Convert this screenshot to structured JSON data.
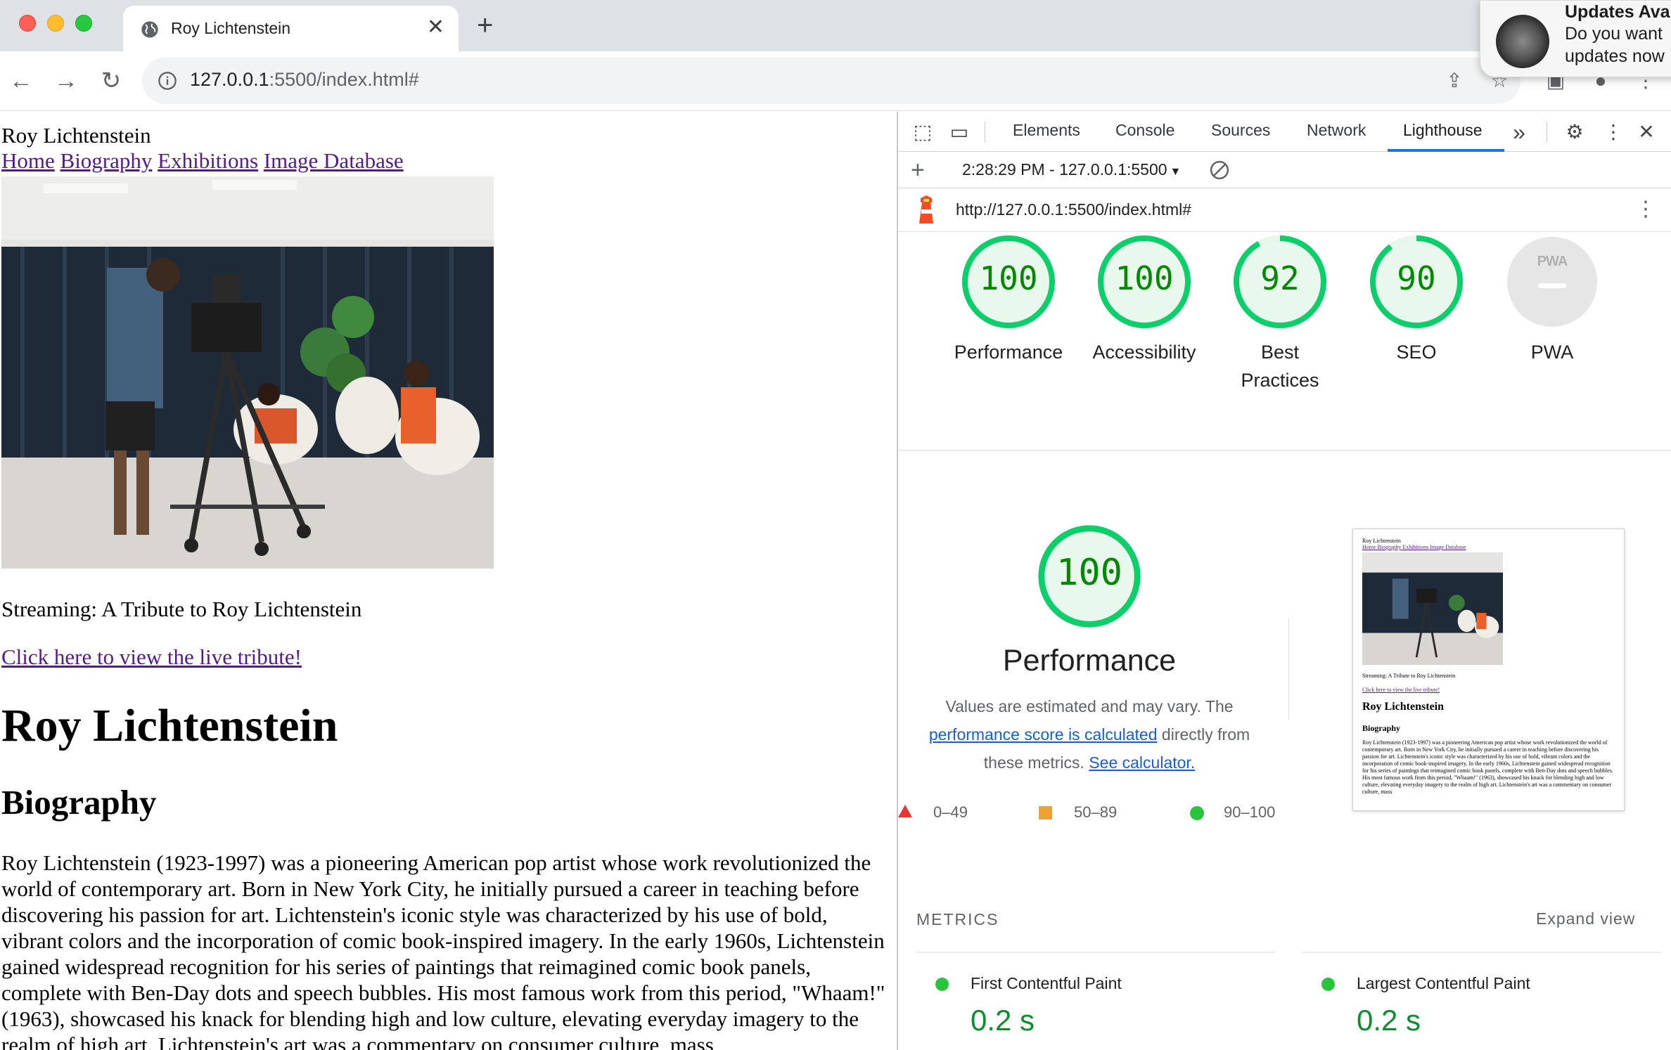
{
  "browser": {
    "tab_title": "Roy Lichtenstein",
    "url_host": "127.0.0.1",
    "url_path": ":5500/index.html#"
  },
  "notification": {
    "title": "Updates Ava",
    "line1": "Do you want",
    "line2": "updates now"
  },
  "page": {
    "site_title": "Roy Lichtenstein",
    "nav": [
      "Home",
      "Biography",
      "Exhibitions",
      "Image Database"
    ],
    "stream_text": "Streaming: A Tribute to Roy Lichtenstein",
    "live_link": "Click here to view the live tribute!",
    "heading": "Roy Lichtenstein",
    "subheading": "Biography",
    "bio": "Roy Lichtenstein (1923-1997) was a pioneering American pop artist whose work revolutionized the world of contemporary art. Born in New York City, he initially pursued a career in teaching before discovering his passion for art. Lichtenstein's iconic style was characterized by his use of bold, vibrant colors and the incorporation of comic book-inspired imagery. In the early 1960s, Lichtenstein gained widespread recognition for his series of paintings that reimagined comic book panels, complete with Ben-Day dots and speech bubbles. His most famous work from this period, \"Whaam!\" (1963), showcased his knack for blending high and low culture, elevating everyday imagery to the realm of high art. Lichtenstein's art was a commentary on consumer culture, mass"
  },
  "devtools": {
    "tabs": [
      "Elements",
      "Console",
      "Sources",
      "Network",
      "Lighthouse"
    ],
    "more": "»",
    "report_label": "2:28:29 PM - 127.0.0.1:5500",
    "report_url": "http://127.0.0.1:5500/index.html#"
  },
  "lighthouse": {
    "scores": [
      {
        "label": "Performance",
        "value": 100
      },
      {
        "label": "Accessibility",
        "value": 100
      },
      {
        "label": "Best Practices",
        "value": 92
      },
      {
        "label": "SEO",
        "value": 90
      },
      {
        "label": "PWA",
        "value": null
      }
    ],
    "pwa_badge": "PWA",
    "perf_score": "100",
    "perf_title": "Performance",
    "perf_desc_1": "Values are estimated and may vary. The",
    "perf_desc_link": "performance score is calculated",
    "perf_desc_2": " directly from",
    "perf_desc_3": "these metrics. ",
    "perf_desc_link2": "See calculator.",
    "legend": [
      "0–49",
      "50–89",
      "90–100"
    ],
    "metrics_heading": "METRICS",
    "expand_view": "Expand view",
    "metrics": [
      {
        "name": "First Contentful Paint",
        "value": "0.2 s"
      },
      {
        "name": "Largest Contentful Paint",
        "value": "0.2 s"
      }
    ],
    "colors": {
      "pass": "#0cce6b",
      "pass_text": "#008800",
      "pwa": "#e0e0e0"
    }
  }
}
